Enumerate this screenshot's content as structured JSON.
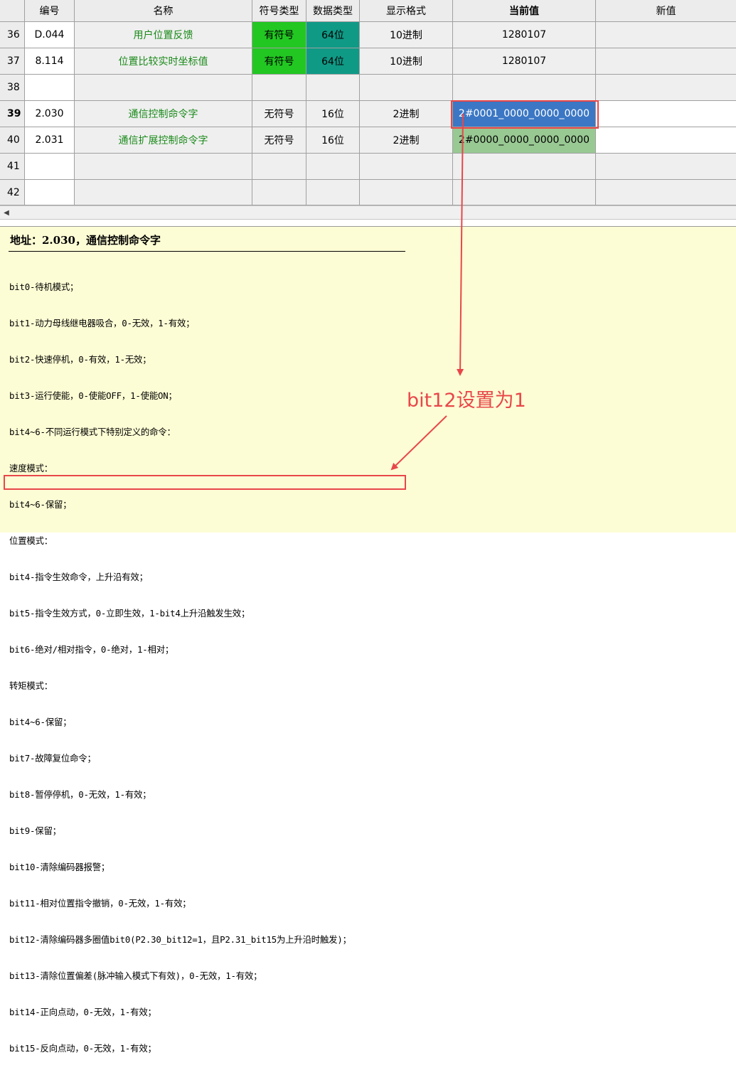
{
  "grid": {
    "headers": {
      "code": "编号",
      "name": "名称",
      "sign": "符号类型",
      "dtype": "数据类型",
      "format": "显示格式",
      "current": "当前值",
      "new": "新值"
    },
    "rows": [
      {
        "num": "36",
        "code": "D.044",
        "name": "用户位置反馈",
        "sign": "有符号",
        "dtype": "64位",
        "format": "10进制",
        "current": "1280107",
        "new": ""
      },
      {
        "num": "37",
        "code": "8.114",
        "name": "位置比较实时坐标值",
        "sign": "有符号",
        "dtype": "64位",
        "format": "10进制",
        "current": "1280107",
        "new": ""
      },
      {
        "num": "38",
        "code": "",
        "name": "",
        "sign": "",
        "dtype": "",
        "format": "",
        "current": "",
        "new": ""
      },
      {
        "num": "39",
        "code": "2.030",
        "name": "通信控制命令字",
        "sign": "无符号",
        "dtype": "16位",
        "format": "2进制",
        "current": "2#0001_0000_0000_0000",
        "new": ""
      },
      {
        "num": "40",
        "code": "2.031",
        "name": "通信扩展控制命令字",
        "sign": "无符号",
        "dtype": "16位",
        "format": "2进制",
        "current": "2#0000_0000_0000_0000",
        "new": ""
      },
      {
        "num": "41",
        "code": "",
        "name": "",
        "sign": "",
        "dtype": "",
        "format": "",
        "current": "",
        "new": ""
      },
      {
        "num": "42",
        "code": "",
        "name": "",
        "sign": "",
        "dtype": "",
        "format": "",
        "current": "",
        "new": ""
      }
    ],
    "scroll_left_arrow": "◀"
  },
  "description": {
    "title": "地址：2.030，通信控制命令字",
    "lines": [
      "bit0-待机模式；",
      "bit1-动力母线继电器吸合，0-无效，1-有效；",
      "bit2-快速停机，0-有效，1-无效；",
      "bit3-运行使能，0-使能OFF，1-使能ON；",
      "bit4~6-不同运行模式下特别定义的命令：",
      "速度模式：",
      "bit4~6-保留；",
      "位置模式：",
      "bit4-指令生效命令，上升沿有效；",
      "bit5-指令生效方式，0-立即生效，1-bit4上升沿触发生效；",
      "bit6-绝对/相对指令，0-绝对，1-相对；",
      "转矩模式：",
      "bit4~6-保留；",
      "bit7-故障复位命令；",
      "bit8-暂停停机，0-无效，1-有效；",
      "bit9-保留；",
      "bit10-清除编码器报警；",
      "bit11-相对位置指令撤销，0-无效，1-有效；",
      "bit12-清除编码器多圈值bit0(P2.30_bit12=1，且P2.31_bit15为上升沿时触发)；",
      "bit13-清除位置偏差(脉冲输入模式下有效)，0-无效，1-有效；",
      "bit14-正向点动，0-无效，1-有效；",
      "bit15-反向点动，0-无效，1-有效；"
    ]
  },
  "annotation": {
    "text": "bit12设置为1",
    "color": "#e8474a"
  },
  "colors": {
    "signed_cell": "#22c722",
    "dtype64_cell": "#0f9a86",
    "selected_cell": "#3b77c4",
    "pale_cell": "#99c993",
    "name_text": "#1a8a1a",
    "desc_background": "#fdfdd5"
  }
}
